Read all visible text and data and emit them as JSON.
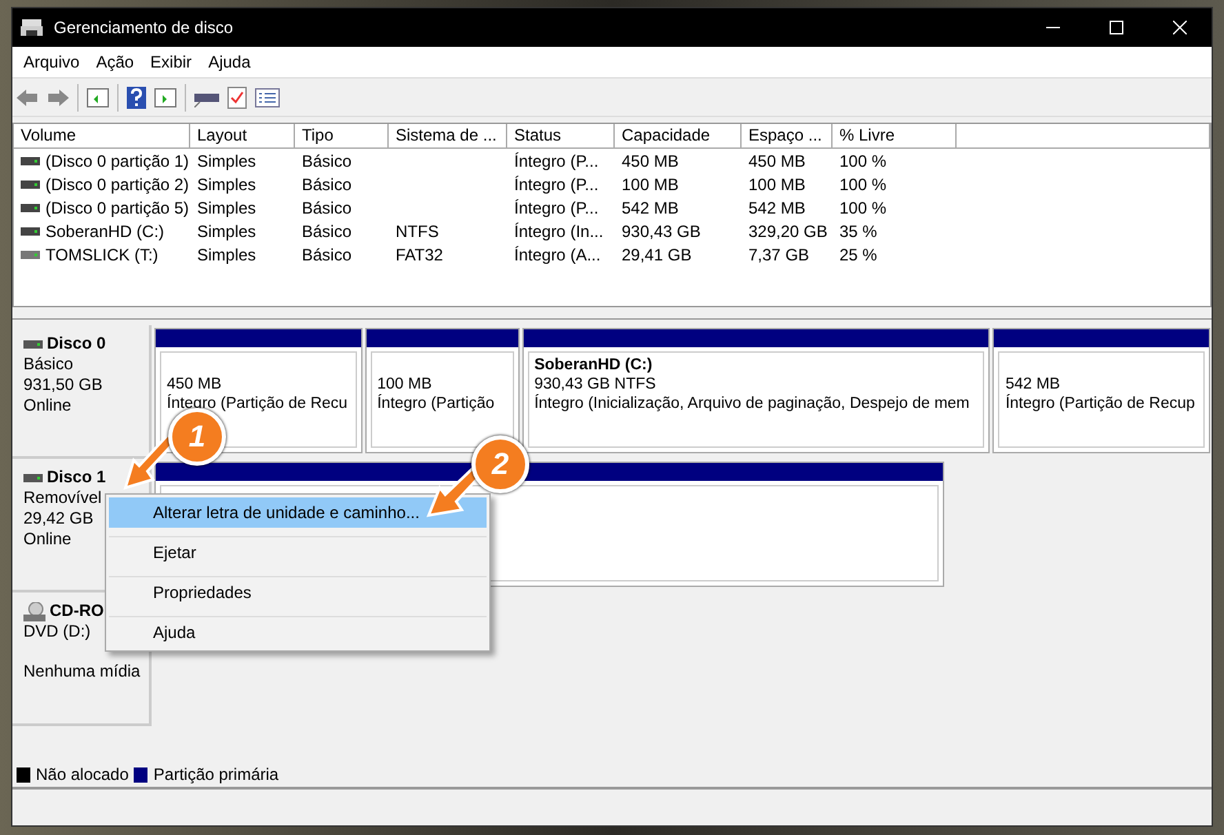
{
  "window": {
    "title": "Gerenciamento de disco"
  },
  "menu": [
    "Arquivo",
    "Ação",
    "Exibir",
    "Ajuda"
  ],
  "table": {
    "columns": [
      "Volume",
      "Layout",
      "Tipo",
      "Sistema de ...",
      "Status",
      "Capacidade",
      "Espaço ...",
      "% Livre"
    ],
    "rows": [
      {
        "cells": [
          "(Disco 0 partição 1)",
          "Simples",
          "Básico",
          "",
          "Íntegro (P...",
          "450 MB",
          "450 MB",
          "100 %"
        ]
      },
      {
        "cells": [
          "(Disco 0 partição 2)",
          "Simples",
          "Básico",
          "",
          "Íntegro (P...",
          "100 MB",
          "100 MB",
          "100 %"
        ]
      },
      {
        "cells": [
          "(Disco 0 partição 5)",
          "Simples",
          "Básico",
          "",
          "Íntegro (P...",
          "542 MB",
          "542 MB",
          "100 %"
        ]
      },
      {
        "cells": [
          "SoberanHD (C:)",
          "Simples",
          "Básico",
          "NTFS",
          "Íntegro (In...",
          "930,43 GB",
          "329,20 GB",
          "35 %"
        ]
      },
      {
        "cells": [
          "TOMSLICK (T:)",
          "Simples",
          "Básico",
          "FAT32",
          "Íntegro (A...",
          "29,41 GB",
          "7,37 GB",
          "25 %"
        ]
      }
    ]
  },
  "disks": [
    {
      "kind": "disk",
      "name": "Disco 0",
      "type": "Básico",
      "size": "931,50 GB",
      "state": "Online",
      "partitions": [
        {
          "kind": "primary",
          "line1": "450 MB",
          "line2": "Íntegro (Partição de Recu"
        },
        {
          "kind": "primary",
          "line1": "100 MB",
          "line2": "Íntegro (Partição"
        },
        {
          "kind": "primary",
          "title": "SoberanHD  (C:)",
          "line1": "930,43 GB NTFS",
          "line2": "Íntegro (Inicialização, Arquivo de paginação, Despejo de mem"
        },
        {
          "kind": "primary",
          "line1": "542 MB",
          "line2": "Íntegro (Partição de Recup"
        }
      ]
    },
    {
      "kind": "disk",
      "name": "Disco 1",
      "type": "Removível",
      "size": "29,42 GB",
      "state": "Online",
      "partitions": [
        {
          "kind": "primary"
        }
      ]
    },
    {
      "kind": "cdrom",
      "name": "CD-RO",
      "type": "DVD (D:)",
      "state": "Nenhuma mídia"
    }
  ],
  "context_menu": [
    {
      "label": "Alterar letra de unidade e caminho...",
      "selected": true
    },
    {
      "label": "Ejetar",
      "selected": false
    },
    {
      "label": "Propriedades",
      "selected": false
    },
    {
      "label": "Ajuda",
      "selected": false
    }
  ],
  "legend": [
    {
      "label": "Não alocado",
      "color": "#000000"
    },
    {
      "label": "Partição primária",
      "color": "#000080"
    }
  ],
  "callouts": [
    "1",
    "2"
  ]
}
